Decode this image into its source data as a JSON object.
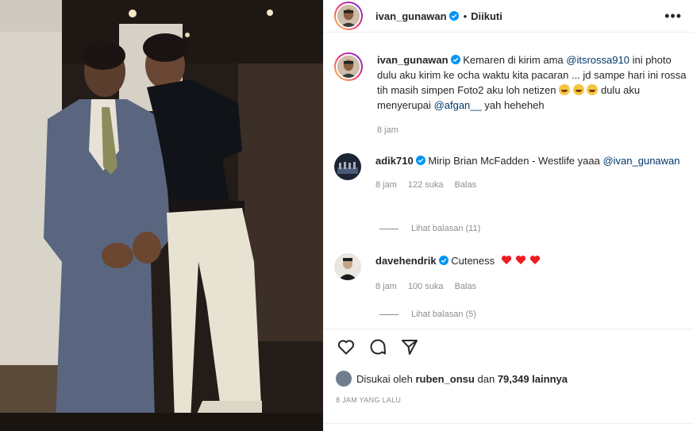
{
  "header": {
    "username": "ivan_gunawan",
    "separator": "•",
    "follow_status": "Diikuti",
    "more_label": "•••"
  },
  "caption": {
    "username": "ivan_gunawan",
    "text_1": "Kemaren di kirim ama",
    "mention_1": "@itsrossa910",
    "text_2": "ini photo dulu aku kirim ke ocha waktu kita pacaran ... jd sampe hari ini rossa tih masih simpen Foto2 aku loh netizen",
    "text_3": "dulu aku menyerupai",
    "mention_2": "@afgan__",
    "text_4": "yah heheheh",
    "time": "8 jam"
  },
  "comments": [
    {
      "username": "adik710",
      "text": "Mirip Brian McFadden - Westlife yaaa",
      "mention": "@ivan_gunawan",
      "time": "8 jam",
      "likes": "122 suka",
      "reply": "Balas",
      "view_replies": "Lihat balasan (11)"
    },
    {
      "username": "davehendrik",
      "text": "Cuteness",
      "time": "8 jam",
      "likes": "100 suka",
      "reply": "Balas",
      "view_replies": "Lihat balasan (5)"
    }
  ],
  "likes": {
    "prefix": "Disukai oleh",
    "user": "ruben_onsu",
    "joiner": "dan",
    "count": "79,349 lainnya"
  },
  "time_ago": "8 JAM YANG LALU",
  "colors": {
    "mention": "#00376b",
    "muted": "#8e8e8e",
    "verified": "#0095f6",
    "heart": "#ed4956"
  },
  "icons": [
    "heart-icon",
    "comment-icon",
    "share-icon",
    "verified-icon"
  ]
}
